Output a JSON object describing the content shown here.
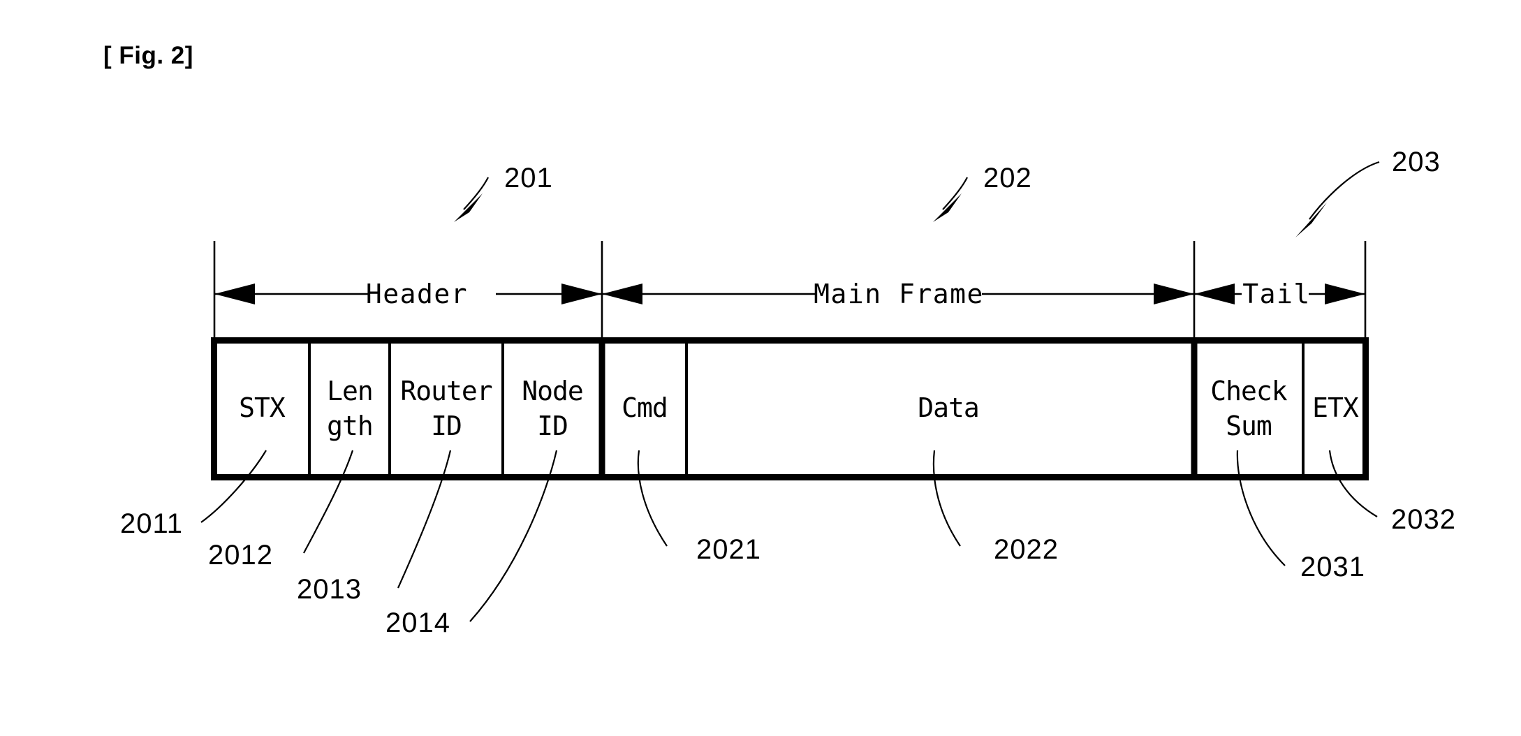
{
  "figure": {
    "label": "[ Fig. 2]",
    "description": "Packet frame structure diagram showing Header, Main Frame and Tail sections"
  },
  "frame": {
    "cells": [
      {
        "id": "stx",
        "label": "STX",
        "lines": [
          "STX"
        ],
        "ref": "2011"
      },
      {
        "id": "length",
        "label": "Length",
        "lines": [
          "Len",
          "gth"
        ],
        "ref": "2012"
      },
      {
        "id": "routerid",
        "label": "Router ID",
        "lines": [
          "Router",
          "ID"
        ],
        "ref": "2013"
      },
      {
        "id": "nodeid",
        "label": "Node ID",
        "lines": [
          "Node",
          "ID"
        ],
        "ref": "2014"
      },
      {
        "id": "cmd",
        "label": "Cmd",
        "lines": [
          "Cmd"
        ],
        "ref": "2021"
      },
      {
        "id": "data",
        "label": "Data",
        "lines": [
          "Data"
        ],
        "ref": "2022"
      },
      {
        "id": "checksum",
        "label": "Check Sum",
        "lines": [
          "Check",
          "Sum"
        ],
        "ref": "2031"
      },
      {
        "id": "etx",
        "label": "ETX",
        "lines": [
          "ETX"
        ],
        "ref": "2032"
      }
    ]
  },
  "sections": [
    {
      "id": "header",
      "label": "Header",
      "ref": "201"
    },
    {
      "id": "main_frame",
      "label": "Main Frame",
      "ref": "202"
    },
    {
      "id": "tail",
      "label": "Tail",
      "ref": "203"
    }
  ],
  "cell_labels": {
    "stx": "STX",
    "length_l1": "Len",
    "length_l2": "gth",
    "router_l1": "Router",
    "router_l2": "ID",
    "node_l1": "Node",
    "node_l2": "ID",
    "cmd": "Cmd",
    "data": "Data",
    "checksum_l1": "Check",
    "checksum_l2": "Sum",
    "etx": "ETX"
  },
  "span_labels": {
    "header": "Header",
    "main_frame": "Main Frame",
    "tail": "Tail"
  },
  "refs": {
    "r201": "201",
    "r202": "202",
    "r203": "203",
    "r2011": "2011",
    "r2012": "2012",
    "r2013": "2013",
    "r2014": "2014",
    "r2021": "2021",
    "r2022": "2022",
    "r2031": "2031",
    "r2032": "2032"
  },
  "colors": {
    "ink": "#000000",
    "paper": "#ffffff"
  }
}
